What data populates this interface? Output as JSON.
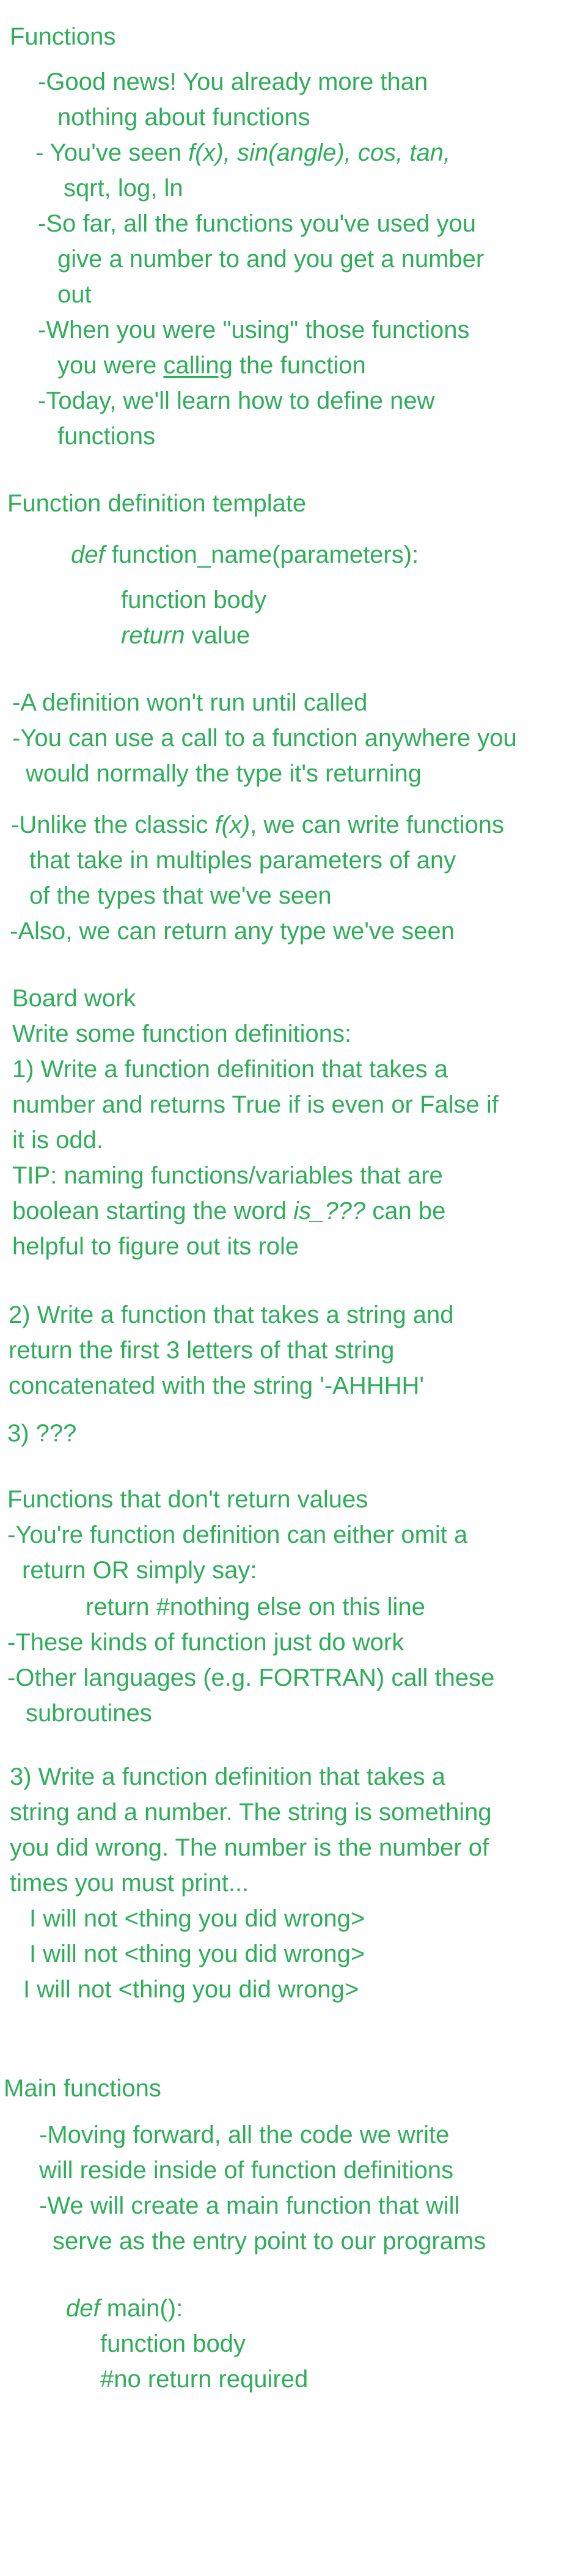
{
  "colors": {
    "text": "#2fae5a",
    "background": "#ffffff"
  },
  "functions_section": {
    "heading": "Functions",
    "b1_l1": "-Good news! You already more than",
    "b1_l2": "nothing about functions",
    "b2_l1_pre": "- You've seen ",
    "b2_l1_it": "f(x), sin(angle), cos, tan,",
    "b2_l2_it": "sqrt, log, ln",
    "b3_l1": "-So far, all the functions you've used you",
    "b3_l2": "give a number to and you get a number",
    "b3_l3": "out",
    "b4_l1": "-When you were \"using\" those functions",
    "b4_l2_pre": "you were ",
    "b4_l2_u": "calling",
    "b4_l2_post": " the function",
    "b5_l1": "-Today, we'll learn how to define new",
    "b5_l2": "functions"
  },
  "template_section": {
    "heading": "Function definition template",
    "def_kw": "def",
    "def_rest": " function_name(parameters):",
    "body": "function body",
    "return_kw": "return",
    "return_rest": " value"
  },
  "notes": {
    "n1": "-A definition won't run until called",
    "n2_l1": "-You can use a call to a function anywhere you",
    "n2_l2": "would normally the type it's returning",
    "n3_l1_pre": "-Unlike the classic ",
    "n3_l1_it": "f(x)",
    "n3_l1_post": ", we can write functions",
    "n3_l2": "that take in multiples parameters of any",
    "n3_l3": "of the types that we've seen",
    "n4": "-Also, we can return any type we've seen"
  },
  "board_work": {
    "heading": "Board work",
    "intro": "Write some function definitions:",
    "q1_l1": "1) Write a function definition that takes a",
    "q1_l2": "number and returns True if is even or False if",
    "q1_l3": "it is odd.",
    "tip_l1": "TIP: naming functions/variables that are",
    "tip_l2_pre": "boolean starting the word ",
    "tip_l2_it": "is_???",
    "tip_l2_post": " can be",
    "tip_l3": "helpful to figure out its role",
    "q2_l1": "2) Write a function that takes a string and",
    "q2_l2": "return the first 3 letters of that string",
    "q2_l3": "concatenated with the string '-AHHHH'",
    "q3": "3) ???"
  },
  "no_return": {
    "heading": "Functions that don't return values",
    "l1": "-You're function definition can either omit a",
    "l2": "return OR simply say:",
    "code_it": "return #nothing else on this line",
    "l3": "-These kinds of function just do work",
    "l4": "-Other languages (e.g. FORTRAN) call these",
    "l5": "subroutines"
  },
  "q3_full": {
    "l1": "3) Write a function definition that takes a",
    "l2": "string and a number. The string is something",
    "l3": "you did wrong. The number is the number of",
    "l4": "times you must print...",
    "rep1": "I will not <thing you did wrong>",
    "rep2": "I will not <thing you did wrong>",
    "rep3": "I will not <thing you did wrong>"
  },
  "main_functions": {
    "heading": "Main functions",
    "b1_l1": "-Moving forward, all the code we write",
    "b1_l2": "will reside inside of function definitions",
    "b2_l1": "-We will create a main function that will",
    "b2_l2": "serve as the entry point to our programs",
    "def_kw": "def",
    "def_rest": " main():",
    "body": "function body",
    "comment": "#no return required"
  }
}
